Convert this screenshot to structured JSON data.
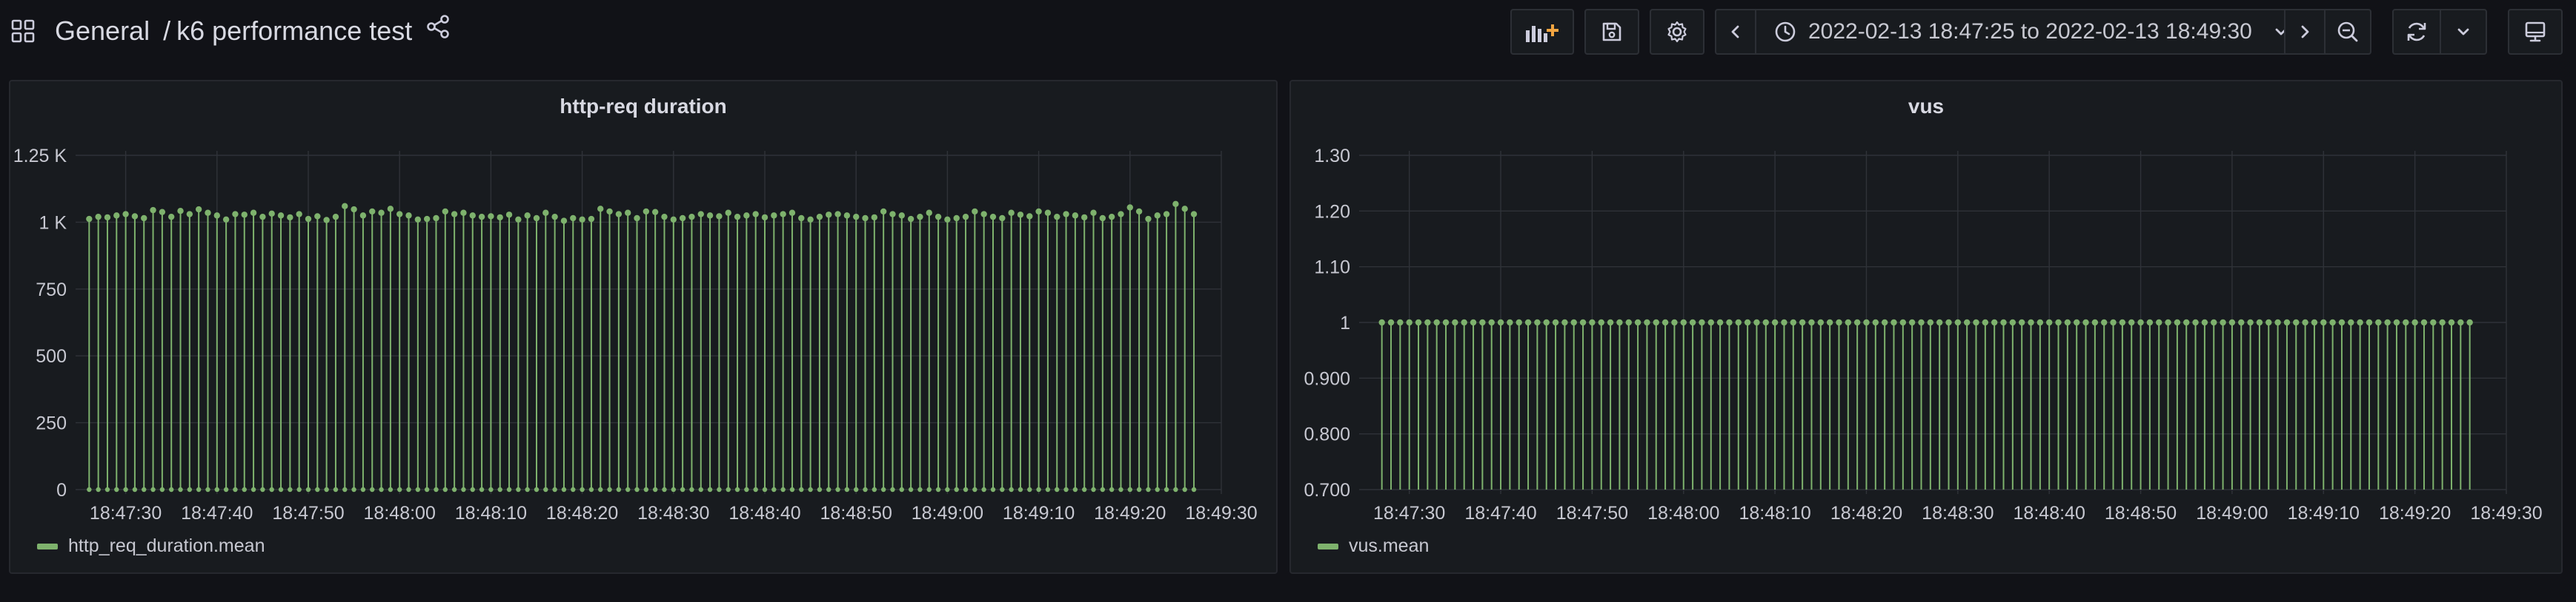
{
  "breadcrumb": {
    "folder": "General",
    "separator": "/",
    "dashboard_title": "k6 performance test"
  },
  "icons": {
    "apps": "apps-grid-icon",
    "share": "share-icon",
    "add_panel": "add-panel-icon",
    "save": "save-icon",
    "settings": "gear-icon",
    "time_back": "chevron-left-icon",
    "clock": "clock-icon",
    "time_forward": "chevron-right-icon",
    "zoom_out": "zoom-out-icon",
    "refresh": "refresh-icon",
    "refresh_interval": "chevron-down-icon",
    "tv_mode": "tv-monitor-icon"
  },
  "time_picker": {
    "range_label": "2022-02-13 18:47:25 to 2022-02-13 18:49:30"
  },
  "colors": {
    "background": "#111217",
    "panel": "#181b1f",
    "series": "#7eb26d",
    "grid": "#2f3238",
    "accent_orange": "#f2a541"
  },
  "panels": [
    {
      "title": "http-req duration",
      "legend": "http_req_duration.mean"
    },
    {
      "title": "vus",
      "legend": "vus.mean"
    }
  ],
  "chart_data": [
    {
      "type": "bar",
      "style": "points with vertical stems from zero (lollipop)",
      "title": "http-req duration",
      "x_ticks": [
        "18:47:30",
        "18:47:40",
        "18:47:50",
        "18:48:00",
        "18:48:10",
        "18:48:20",
        "18:48:30",
        "18:48:40",
        "18:48:50",
        "18:49:00",
        "18:49:10",
        "18:49:20",
        "18:49:30"
      ],
      "y_ticks": [
        "0",
        "250",
        "500",
        "750",
        "1 K",
        "1.25 K"
      ],
      "ylim": [
        0,
        1250
      ],
      "xlim": [
        "18:47:25",
        "18:49:30"
      ],
      "grid": true,
      "legend_position": "bottom-left",
      "series": [
        {
          "name": "http_req_duration.mean",
          "x_start": "18:47:26",
          "x_step_seconds": 1,
          "values": [
            1012,
            1020,
            1018,
            1025,
            1030,
            1022,
            1015,
            1045,
            1038,
            1020,
            1042,
            1030,
            1048,
            1035,
            1025,
            1010,
            1030,
            1028,
            1035,
            1020,
            1032,
            1025,
            1018,
            1030,
            1012,
            1022,
            1008,
            1020,
            1060,
            1048,
            1025,
            1040,
            1035,
            1050,
            1030,
            1025,
            1010,
            1012,
            1015,
            1040,
            1030,
            1035,
            1025,
            1020,
            1022,
            1018,
            1028,
            1010,
            1025,
            1015,
            1035,
            1020,
            1005,
            1015,
            1010,
            1012,
            1050,
            1040,
            1030,
            1035,
            1015,
            1040,
            1038,
            1020,
            1010,
            1015,
            1020,
            1030,
            1025,
            1022,
            1035,
            1020,
            1025,
            1030,
            1018,
            1025,
            1030,
            1035,
            1015,
            1010,
            1020,
            1028,
            1030,
            1025,
            1020,
            1015,
            1018,
            1040,
            1030,
            1025,
            1012,
            1020,
            1035,
            1020,
            1010,
            1015,
            1020,
            1040,
            1030,
            1020,
            1015,
            1035,
            1028,
            1022,
            1040,
            1035,
            1020,
            1030,
            1025,
            1018,
            1035,
            1015,
            1020,
            1030,
            1055,
            1040,
            1012,
            1025,
            1030,
            1068,
            1050,
            1030
          ]
        }
      ]
    },
    {
      "type": "bar",
      "style": "points with vertical stems from axis minimum (lollipop)",
      "title": "vus",
      "x_ticks": [
        "18:47:30",
        "18:47:40",
        "18:47:50",
        "18:48:00",
        "18:48:10",
        "18:48:20",
        "18:48:30",
        "18:48:40",
        "18:48:50",
        "18:49:00",
        "18:49:10",
        "18:49:20",
        "18:49:30"
      ],
      "y_ticks": [
        "0.700",
        "0.800",
        "0.900",
        "1",
        "1.10",
        "1.20",
        "1.30"
      ],
      "ylim": [
        0.7,
        1.3
      ],
      "xlim": [
        "18:47:25",
        "18:49:30"
      ],
      "grid": true,
      "legend_position": "bottom-left",
      "series": [
        {
          "name": "vus.mean",
          "x_start": "18:47:27",
          "x_step_seconds": 1,
          "count": 120,
          "constant_value": 1
        }
      ]
    }
  ]
}
